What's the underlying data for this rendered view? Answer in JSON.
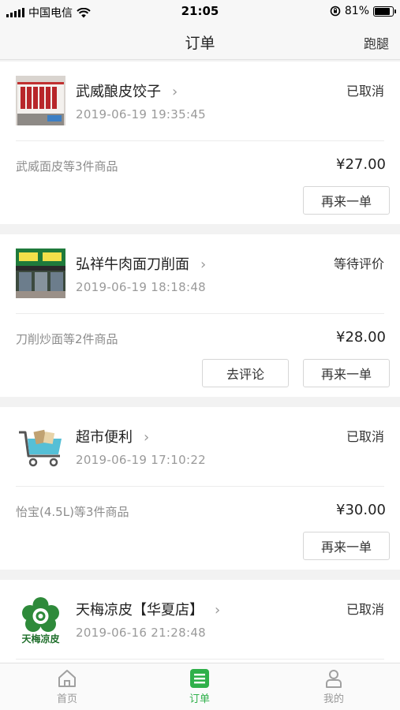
{
  "status_bar": {
    "carrier": "中国电信",
    "time": "21:05",
    "battery_percent": "81%",
    "battery_level": 0.81
  },
  "navbar": {
    "title": "订单",
    "right_action": "跑腿"
  },
  "orders": [
    {
      "shop": "武威酿皮饺子",
      "time": "2019-06-19 19:35:45",
      "status": "已取消",
      "items": "武威面皮等3件商品",
      "price": "¥27.00",
      "reorder_label": "再来一单",
      "thumb_text": "武威酿皮饺子"
    },
    {
      "shop": "弘祥牛肉面刀削面",
      "time": "2019-06-19 18:18:48",
      "status": "等待评价",
      "items": "刀削炒面等2件商品",
      "price": "¥28.00",
      "review_label": "去评论",
      "reorder_label": "再来一单"
    },
    {
      "shop": "超市便利",
      "time": "2019-06-19 17:10:22",
      "status": "已取消",
      "items": "怡宝(4.5L)等3件商品",
      "price": "¥30.00",
      "reorder_label": "再来一单"
    },
    {
      "shop": "天梅凉皮【华夏店】",
      "time": "2019-06-16 21:28:48",
      "status": "已取消",
      "thumb_text": "天梅凉皮"
    }
  ],
  "tabbar": {
    "tabs": [
      {
        "label": "首页",
        "icon": "home-icon"
      },
      {
        "label": "订单",
        "icon": "orders-icon",
        "active": true
      },
      {
        "label": "我的",
        "icon": "profile-icon"
      }
    ],
    "active_color": "#2fb04a"
  }
}
